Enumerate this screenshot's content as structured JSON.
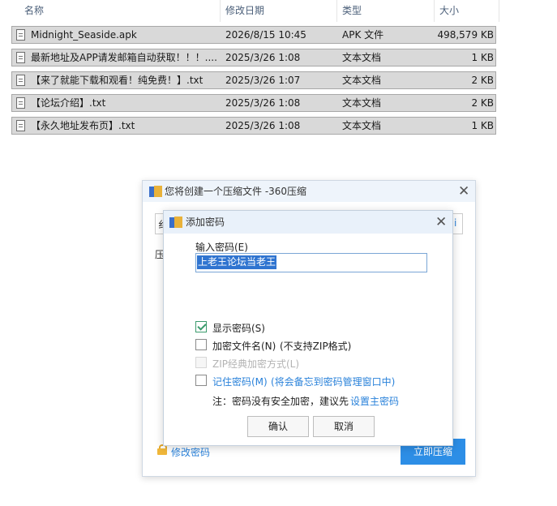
{
  "columns": {
    "name": "名称",
    "date": "修改日期",
    "type": "类型",
    "size": "大小"
  },
  "files": [
    {
      "name": "Midnight_Seaside.apk",
      "date": "2026/8/15 10:45",
      "type": "APK 文件",
      "size": "498,579 KB"
    },
    {
      "name": "最新地址及APP请发邮箱自动获取！！！....",
      "date": "2025/3/26 1:08",
      "type": "文本文档",
      "size": "1 KB"
    },
    {
      "name": "【来了就能下载和观看！纯免费！】.txt",
      "date": "2025/3/26 1:07",
      "type": "文本文档",
      "size": "2 KB"
    },
    {
      "name": "【论坛介绍】.txt",
      "date": "2025/3/26 1:08",
      "type": "文本文档",
      "size": "2 KB"
    },
    {
      "name": "【永久地址发布页】.txt",
      "date": "2025/3/26 1:08",
      "type": "文本文档",
      "size": "1 KB"
    }
  ],
  "create_dialog": {
    "title": "您将创建一个压缩文件 -360压缩",
    "frag1": "纟",
    "frag2": "压",
    "frag3": "i",
    "modify_password": "修改密码",
    "start_button": "立即压缩"
  },
  "password_dialog": {
    "title": "添加密码",
    "input_label": "输入密码(E)",
    "password_value": "上老王论坛当老王",
    "show_password": {
      "label": "显示密码(S)",
      "checked": true
    },
    "encrypt_names": {
      "label": "加密文件名(N)",
      "note": "(不支持ZIP格式)",
      "checked": false
    },
    "zip_classic": {
      "label": "ZIP经典加密方式(L)",
      "checked": false
    },
    "remember": {
      "label": "记住密码(M)",
      "note": "(将会备忘到密码管理窗口中)",
      "checked": false
    },
    "note_prefix": "注：密码没有安全加密，建议先",
    "note_link": "设置主密码",
    "ok": "确认",
    "cancel": "取消"
  },
  "colors": {
    "accent": "#2d8ee6",
    "link": "#2a82da",
    "check": "#3b9b6d"
  }
}
